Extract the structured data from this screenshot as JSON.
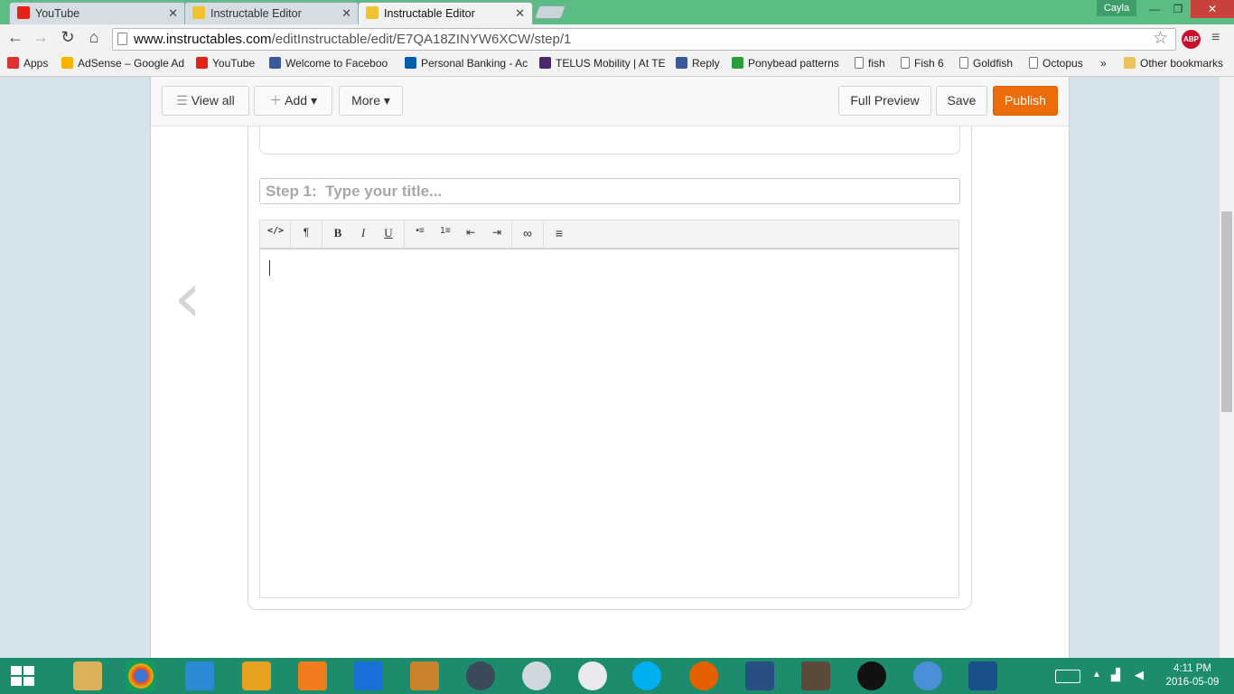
{
  "browser": {
    "tabs": [
      {
        "label": "YouTube",
        "active": false
      },
      {
        "label": "Instructable Editor",
        "active": false
      },
      {
        "label": "Instructable Editor",
        "active": true
      }
    ],
    "profile": "Cayla",
    "url_host": "www.instructables.com",
    "url_path": "/editInstructable/edit/E7QA18ZINYW6XCW/step/1",
    "abp": "ABP"
  },
  "bookmarks": [
    {
      "label": "Apps",
      "color": "#d33"
    },
    {
      "label": "AdSense – Google Ad",
      "color": "#f4b400"
    },
    {
      "label": "YouTube",
      "color": "#e62117"
    },
    {
      "label": "Welcome to Faceboo",
      "color": "#3b5998"
    },
    {
      "label": "Personal Banking - Ac",
      "color": "#005daa"
    },
    {
      "label": "TELUS Mobility | At TE",
      "color": "#4b286d"
    },
    {
      "label": "Reply",
      "color": "#3b5998"
    },
    {
      "label": "Ponybead patterns",
      "color": "#2a9d3e"
    },
    {
      "label": "fish",
      "color": "#ffffff"
    },
    {
      "label": "Fish 6",
      "color": "#ffffff"
    },
    {
      "label": "Goldfish",
      "color": "#ffffff"
    },
    {
      "label": "Octopus",
      "color": "#ffffff"
    }
  ],
  "bookmarks_more": "»",
  "other_bookmarks": "Other bookmarks",
  "editor": {
    "view_all": "View all",
    "add": "Add",
    "more": "More",
    "full_preview": "Full Preview",
    "save": "Save",
    "publish": "Publish",
    "title_placeholder": "Step 1:  Type your title...",
    "prev_arrow": "‹"
  },
  "toolbar_buttons": [
    "</>",
    "¶",
    "B",
    "I",
    "U",
    "•≡",
    "1≡",
    "⇤",
    "⇥",
    "∞",
    "≡"
  ],
  "colors": {
    "accent": "#ec6c0a",
    "chrome": "#5bbd84",
    "taskbar": "#1d8c6c"
  },
  "clock": {
    "time": "4:11 PM",
    "date": "2016-05-09"
  }
}
